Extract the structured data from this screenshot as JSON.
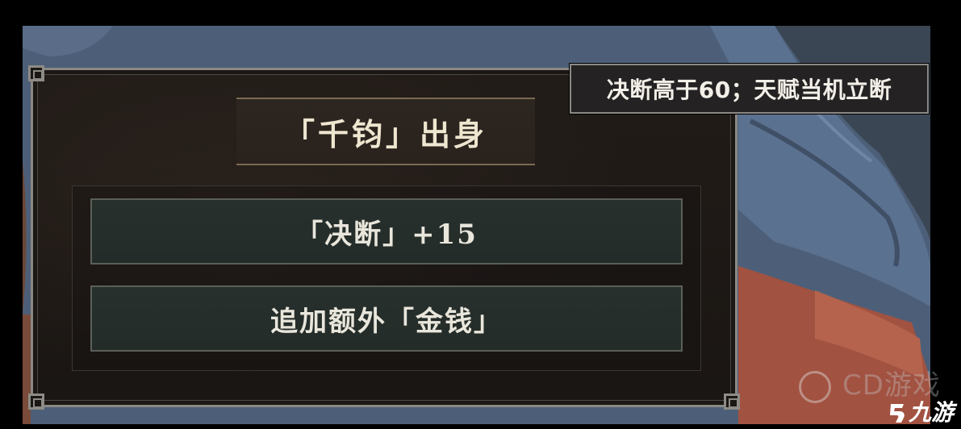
{
  "card": {
    "title": "「千钧」出身",
    "options": [
      {
        "label": "「决断」+15"
      },
      {
        "label": "追加额外「金钱」"
      }
    ]
  },
  "tooltip": {
    "text": "决断高于60；天赋当机立断"
  },
  "watermarks": {
    "cd_text": "CD游戏",
    "logo_text": "九游"
  },
  "colors": {
    "panel_border": "#8a8883",
    "title_text": "#efe6d0",
    "row_background": "#26302c",
    "tooltip_background": "#242222"
  },
  "icons": [
    "background-character-art",
    "panel-corner-ornament",
    "cd-watermark-circle-icon",
    "jiuyou-logo-icon"
  ]
}
